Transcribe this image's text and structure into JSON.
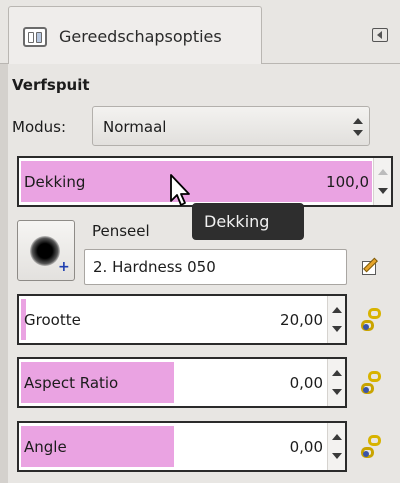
{
  "tab": {
    "label": "Gereedschapsopties",
    "icon": "tool-options-icon"
  },
  "tool": {
    "title": "Verfspuit",
    "mode_label": "Modus:",
    "mode_value": "Normaal"
  },
  "opacity": {
    "label": "Dekking",
    "value": "100,0",
    "fill_percent": 100
  },
  "tooltip": {
    "text": "Dekking"
  },
  "brush": {
    "label": "Penseel",
    "value": "2. Hardness 050"
  },
  "sliders": [
    {
      "label": "Grootte",
      "value": "20,00",
      "fill_percent": 1.5
    },
    {
      "label": "Aspect Ratio",
      "value": "0,00",
      "fill_percent": 50
    },
    {
      "label": "Angle",
      "value": "0,00",
      "fill_percent": 50
    }
  ],
  "colors": {
    "slider_fill": "#eaa3e2",
    "panel_bg": "#e8e6e3"
  }
}
